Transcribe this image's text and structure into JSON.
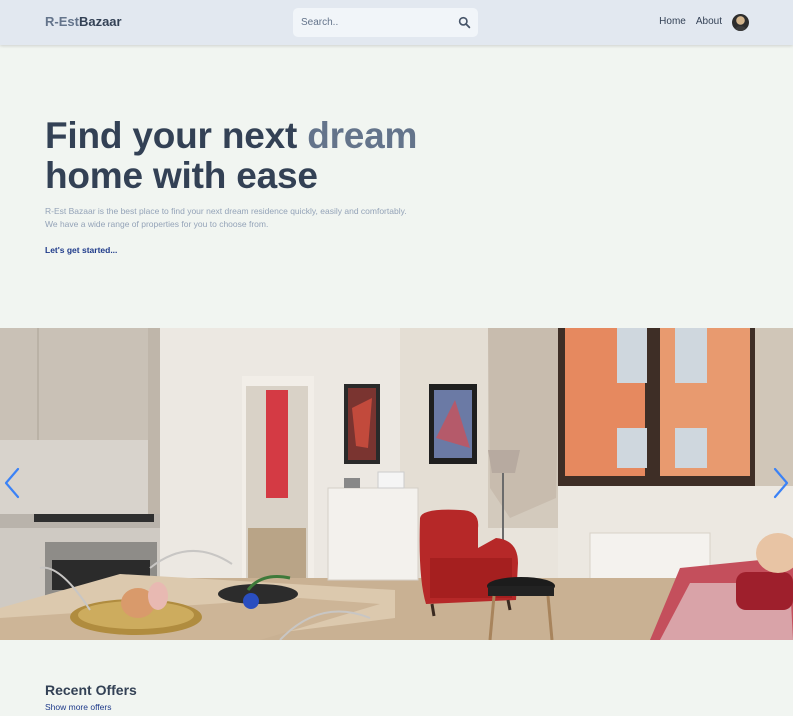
{
  "header": {
    "logo_part1": "R-Est",
    "logo_part2": "Bazaar",
    "search_placeholder": "Search..",
    "nav": [
      {
        "label": "Home"
      },
      {
        "label": "About"
      }
    ]
  },
  "hero": {
    "title_line1_a": "Find your next ",
    "title_line1_accent": "dream",
    "title_line2": "home with ease",
    "description_line1": "R-Est Bazaar is the best place to find your next dream residence quickly, easily and comfortably.",
    "description_line2": "We have a wide range of properties for you to choose from.",
    "cta_label": "Let's get started..."
  },
  "slider": {
    "prev_icon": "chevron-left-icon",
    "next_icon": "chevron-right-icon",
    "arrow_color": "#3b82f6"
  },
  "offers": {
    "title": "Recent Offers",
    "show_more_label": "Show more offers"
  },
  "colors": {
    "header_bg": "#e2e8f0",
    "page_bg": "#f1f5f1",
    "text_dark": "#334155",
    "text_accent": "#64748b",
    "link": "#1e3a8a"
  }
}
